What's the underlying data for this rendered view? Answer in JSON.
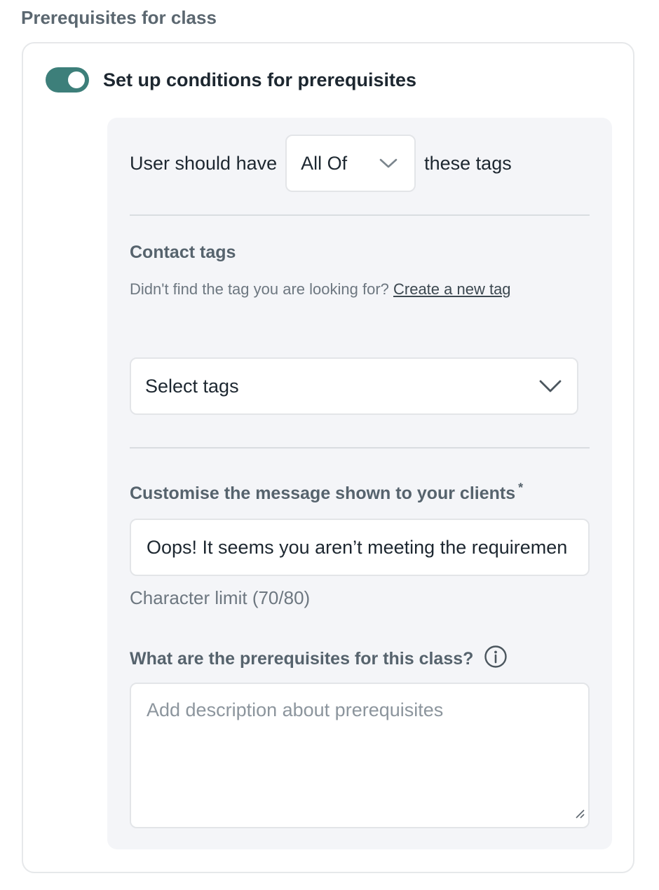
{
  "section": {
    "title": "Prerequisites for class"
  },
  "toggle": {
    "label": "Set up conditions for prerequisites",
    "on": true
  },
  "condition": {
    "prefix": "User should have",
    "selected": "All Of",
    "suffix": "these tags"
  },
  "contact_tags": {
    "title": "Contact tags",
    "hint": "Didn't find the tag you are looking for?",
    "link": "Create a new tag",
    "placeholder": "Select tags"
  },
  "message": {
    "title": "Customise the message shown to your clients",
    "required_mark": "*",
    "value": "Oops! It seems you aren’t meeting the requiremen",
    "char_limit": "Character limit (70/80)"
  },
  "prerequisites": {
    "title": "What are the prerequisites for this class?",
    "placeholder": "Add description about prerequisites"
  },
  "colors": {
    "accent": "#3d7f7a",
    "panel_bg": "#f4f5f8",
    "muted_text": "#5b6770"
  },
  "icons": {
    "toggle": "toggle-switch",
    "dropdown": "chevron-down-icon",
    "info": "info-circle-icon",
    "resize": "resize-handle-icon"
  }
}
